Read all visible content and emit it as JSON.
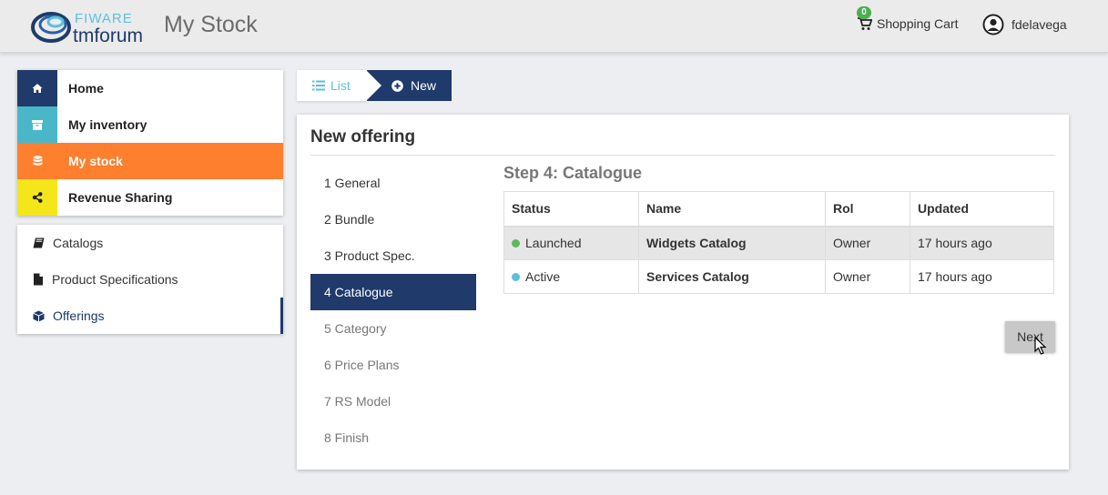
{
  "header": {
    "logo_top": "FIWARE",
    "logo_bottom": "tmforum",
    "title": "My Stock",
    "cart_count": "0",
    "cart_label": "Shopping Cart",
    "username": "fdelavega"
  },
  "nav": {
    "main": [
      {
        "label": "Home",
        "icon": "home-icon",
        "color": "#1f3a6b"
      },
      {
        "label": "My inventory",
        "icon": "archive-icon",
        "color": "#4ab7c9"
      },
      {
        "label": "My stock",
        "icon": "database-icon",
        "color": "#fe7f2d"
      },
      {
        "label": "Revenue Sharing",
        "icon": "share-icon",
        "color": "#f5e61b"
      }
    ],
    "sub": [
      {
        "label": "Catalogs",
        "icon": "book-icon"
      },
      {
        "label": "Product Specifications",
        "icon": "file-icon"
      },
      {
        "label": "Offerings",
        "icon": "cube-icon"
      }
    ]
  },
  "breadcrumb": {
    "list": "List",
    "new": "New"
  },
  "panel": {
    "title": "New offering",
    "steps": [
      "1 General",
      "2 Bundle",
      "3 Product Spec.",
      "4 Catalogue",
      "5 Category",
      "6 Price Plans",
      "7 RS Model",
      "8 Finish"
    ],
    "step_title": "Step 4: Catalogue",
    "table": {
      "headers": [
        "Status",
        "Name",
        "Rol",
        "Updated"
      ],
      "rows": [
        {
          "status": "Launched",
          "status_color": "#5cb85c",
          "name": "Widgets Catalog",
          "rol": "Owner",
          "updated": "17 hours ago"
        },
        {
          "status": "Active",
          "status_color": "#5bc0de",
          "name": "Services Catalog",
          "rol": "Owner",
          "updated": "17 hours ago"
        }
      ]
    },
    "next": "Next"
  },
  "colors": {
    "navy": "#1f3a6b",
    "orange": "#fe7f2d",
    "teal": "#4ab7c9",
    "yellow": "#f5e61b"
  }
}
